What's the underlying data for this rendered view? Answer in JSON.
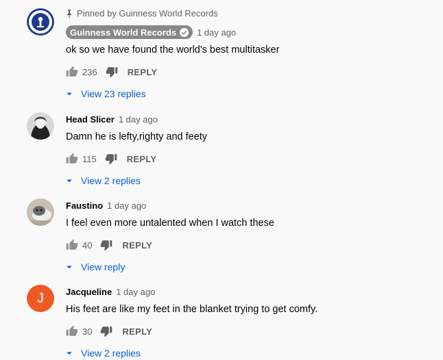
{
  "colors": {
    "link": "#065fd4",
    "muted": "#606060",
    "text": "#030303",
    "badge": "#888888",
    "avatar_j": "#ef5a24"
  },
  "comments": [
    {
      "pinned_label": "Pinned by Guinness World Records",
      "author": "Guinness World Records",
      "time": "1 day ago",
      "text": "ok so we have found the world's best multitasker",
      "likes": "236",
      "reply_label": "REPLY",
      "view_replies": "View 23 replies"
    },
    {
      "author": "Head Slicer",
      "time": "1 day ago",
      "text": "Damn he is lefty,righty and feety",
      "likes": "115",
      "reply_label": "REPLY",
      "view_replies": "View 2 replies"
    },
    {
      "author": "Faustino",
      "time": "1 day ago",
      "text": "I feel even more untalented when I watch these",
      "likes": "40",
      "reply_label": "REPLY",
      "view_replies": "View reply"
    },
    {
      "author": "Jacqueline",
      "avatar_letter": "J",
      "time": "1 day ago",
      "text": "His feet are like my feet in the blanket trying to get comfy.",
      "likes": "30",
      "reply_label": "REPLY",
      "view_replies": "View 2 replies"
    }
  ]
}
